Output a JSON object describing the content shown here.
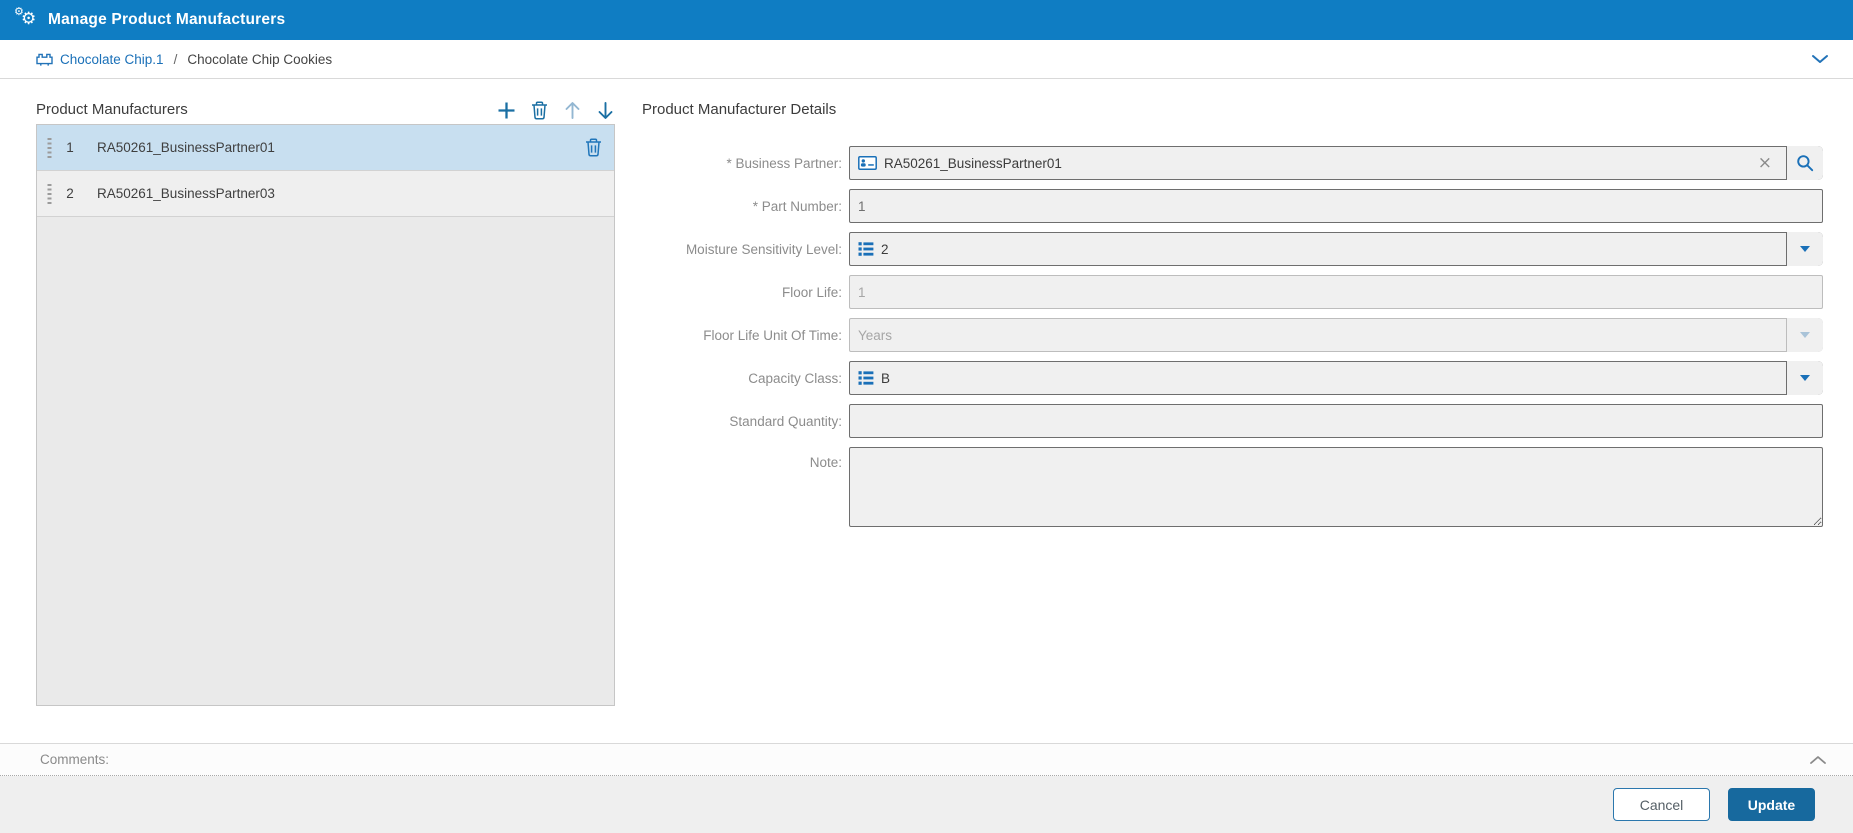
{
  "window": {
    "title": "Manage Product Manufacturers"
  },
  "breadcrumb": {
    "link_label": "Chocolate Chip.1",
    "separator": "/",
    "current_label": "Chocolate Chip Cookies"
  },
  "manufacturers_panel": {
    "title": "Product Manufacturers",
    "toolbar": [
      "add",
      "delete",
      "move-up",
      "move-down"
    ],
    "items": [
      {
        "index": "1",
        "name": "RA50261_BusinessPartner01",
        "selected": true
      },
      {
        "index": "2",
        "name": "RA50261_BusinessPartner03",
        "selected": false
      }
    ]
  },
  "details_panel": {
    "title": "Product Manufacturer Details",
    "fields": {
      "business_partner": {
        "label": "* Business Partner:",
        "value": "RA50261_BusinessPartner01",
        "required": true
      },
      "part_number": {
        "label": "* Part Number:",
        "value": "1",
        "required": true
      },
      "moisture_sensitivity_level": {
        "label": "Moisture Sensitivity Level:",
        "value": "2"
      },
      "floor_life": {
        "label": "Floor Life:",
        "value": "1",
        "disabled": true
      },
      "floor_life_unit": {
        "label": "Floor Life Unit Of Time:",
        "value": "Years",
        "disabled": true
      },
      "capacity_class": {
        "label": "Capacity Class:",
        "value": "B"
      },
      "standard_quantity": {
        "label": "Standard Quantity:",
        "value": ""
      },
      "note": {
        "label": "Note:",
        "value": ""
      }
    }
  },
  "comments": {
    "label": "Comments:"
  },
  "footer": {
    "cancel_label": "Cancel",
    "update_label": "Update"
  },
  "icons": {
    "clear_glyph": "×",
    "gear_glyph": "⚙",
    "names": [
      "gears-icon",
      "part-icon",
      "chevron-down-icon",
      "plus-icon",
      "trash-icon",
      "arrow-up-icon",
      "arrow-down-icon",
      "grip-dots-icon",
      "id-card-icon",
      "x-icon",
      "magnifier-icon",
      "caret-down-icon",
      "enum-list-icon",
      "chevron-up-icon"
    ]
  },
  "colors": {
    "header_blue": "#0f7dc3",
    "accent_blue": "#1a70b8",
    "selected_row": "#c8dff0",
    "update_button": "#17699e",
    "field_bg": "#f0f0f0"
  }
}
